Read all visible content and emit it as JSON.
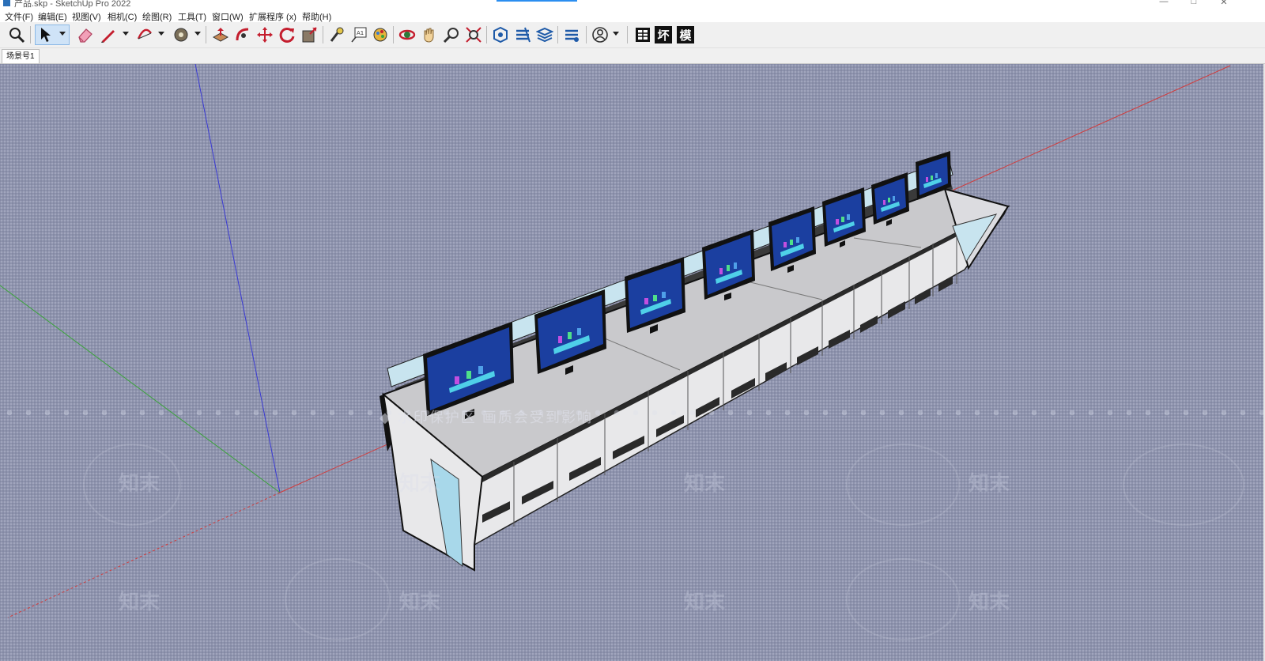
{
  "window": {
    "title": "产品.skp - SketchUp Pro 2022",
    "minimize": "—",
    "maximize": "□",
    "close": "✕"
  },
  "menu": [
    {
      "label": "文件(F)"
    },
    {
      "label": "编辑(E)"
    },
    {
      "label": "视图(V)"
    },
    {
      "label": "相机(C)"
    },
    {
      "label": "绘图(R)"
    },
    {
      "label": "工具(T)"
    },
    {
      "label": "窗口(W)"
    },
    {
      "label": "扩展程序 (x)"
    },
    {
      "label": "帮助(H)"
    }
  ],
  "toolbar": {
    "tools": [
      "zoom-icon",
      "select-icon",
      "eraser-icon",
      "line-icon",
      "arc-icon",
      "paint-bucket-icon",
      "push-pull-icon",
      "follow-me-icon",
      "move-icon",
      "rotate-icon",
      "scale-icon",
      "tape-measure-icon",
      "text-icon",
      "paint-icon",
      "orbit-icon",
      "pan-icon",
      "zoom-window-icon",
      "zoom-extents-icon",
      "warehouse-icon",
      "extension-icon",
      "layers-icon",
      "extension-manager-icon",
      "user-icon",
      "classifier-icon"
    ],
    "text_tools": [
      {
        "label": "坏"
      },
      {
        "label": "模"
      }
    ]
  },
  "scenes": {
    "tabs": [
      {
        "label": "场景号1"
      }
    ]
  },
  "viewport": {
    "watermark_text": "◆ 水印保护区  画质会受到影响",
    "watermark_logo": "知末",
    "axis_colors": {
      "x": "#d23a3a",
      "y": "#3aa33a",
      "z": "#3a3ad2"
    },
    "background": "#8e93ad"
  }
}
